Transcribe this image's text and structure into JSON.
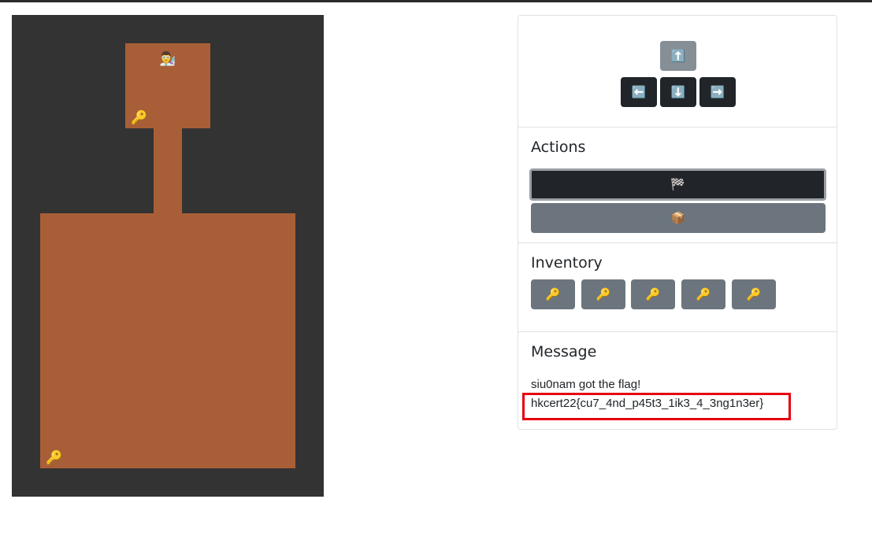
{
  "board": {
    "player_icon": "👨‍🔬",
    "keys_on_floor": [
      "🔑",
      "🔑"
    ]
  },
  "dpad": {
    "up": "⬆️",
    "left": "⬅️",
    "down": "⬇️",
    "right": "➡️"
  },
  "actions": {
    "title": "Actions",
    "finish_icon": "🏁",
    "open_icon": "📦"
  },
  "inventory": {
    "title": "Inventory",
    "items": [
      "🔑",
      "🔑",
      "🔑",
      "🔑",
      "🔑"
    ]
  },
  "message": {
    "title": "Message",
    "line1": "siu0nam got the flag!",
    "line2": "hkcert22{cu7_4nd_p45t3_1ik3_4_3ng1n3er}"
  },
  "colors": {
    "wall": "#333333",
    "floor": "#a85f37",
    "button_dark": "#212529",
    "button_grey": "#6c757d",
    "highlight": "#e5000f"
  }
}
